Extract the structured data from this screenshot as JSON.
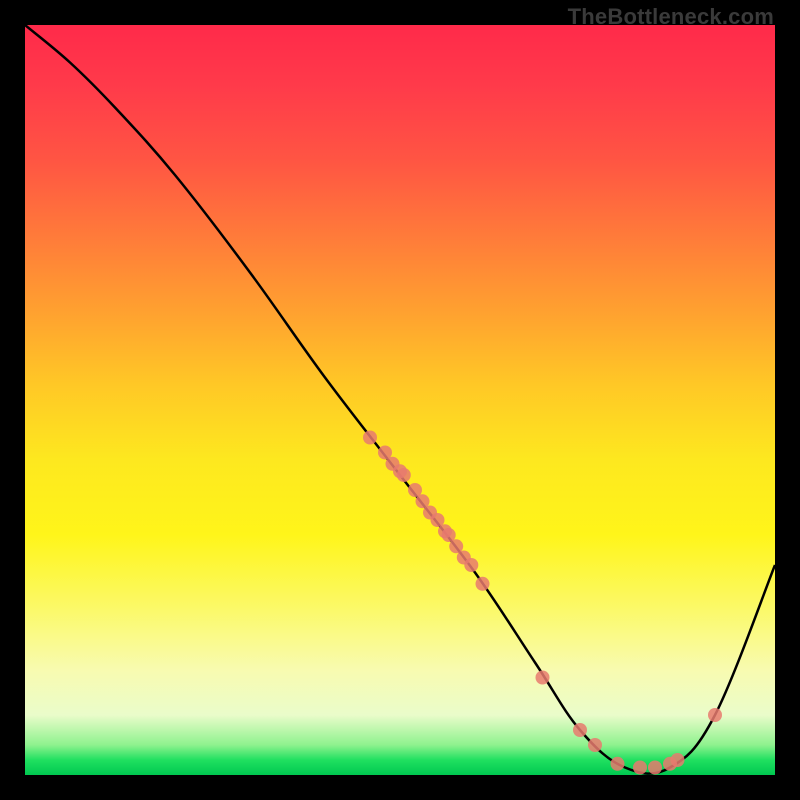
{
  "watermark": "TheBottleneck.com",
  "chart_data": {
    "type": "line",
    "title": "",
    "xlabel": "",
    "ylabel": "",
    "xlim": [
      0,
      100
    ],
    "ylim": [
      0,
      100
    ],
    "curve": {
      "x": [
        0,
        6,
        12,
        20,
        30,
        40,
        50,
        60,
        68,
        74,
        80,
        86,
        92,
        100
      ],
      "y": [
        100,
        95,
        89,
        80,
        67,
        53,
        40,
        27,
        15,
        6,
        1,
        1,
        8,
        28
      ]
    },
    "series": [
      {
        "name": "points",
        "x": [
          46,
          48,
          49,
          50,
          50.5,
          52,
          53,
          54,
          55,
          56,
          56.5,
          57.5,
          58.5,
          59.5,
          61,
          69,
          74,
          76,
          79,
          82,
          84,
          86,
          87,
          92
        ],
        "y": [
          45,
          43,
          41.5,
          40.5,
          40,
          38,
          36.5,
          35,
          34,
          32.5,
          32,
          30.5,
          29,
          28,
          25.5,
          13,
          6,
          4,
          1.5,
          1,
          1,
          1.5,
          2,
          8
        ]
      }
    ]
  }
}
